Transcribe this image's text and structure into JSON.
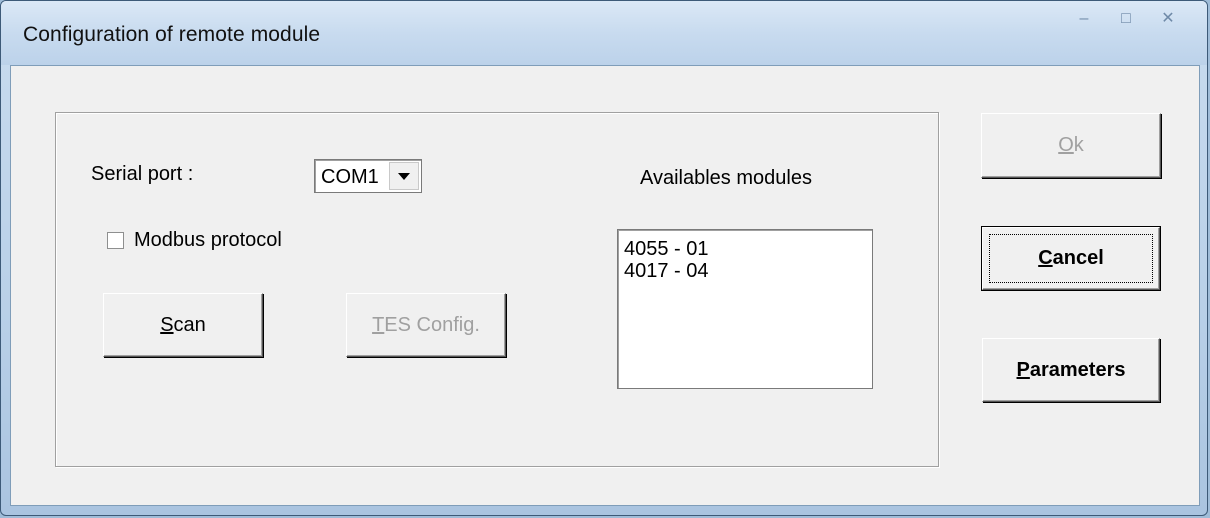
{
  "window": {
    "title": "Configuration of remote module"
  },
  "form": {
    "serial_port_label": "Serial port :",
    "serial_port_value": "COM1",
    "modbus_label": "Modbus protocol",
    "modbus_checked": false,
    "scan_label_mnemonic": "S",
    "scan_label_rest": "can",
    "tes_label_mnemonic": "T",
    "tes_label_rest": "ES Config.",
    "modules_header": "Availables modules",
    "modules": [
      "4055 - 01",
      "4017 - 04"
    ]
  },
  "actions": {
    "ok_mnemonic": "O",
    "ok_rest": "k",
    "cancel_mnemonic": "C",
    "cancel_rest": "ancel",
    "params_mnemonic": "P",
    "params_rest": "arameters"
  },
  "colors": {
    "dialog_bg": "#f0f0f0",
    "disabled_text": "#a0a0a0"
  }
}
